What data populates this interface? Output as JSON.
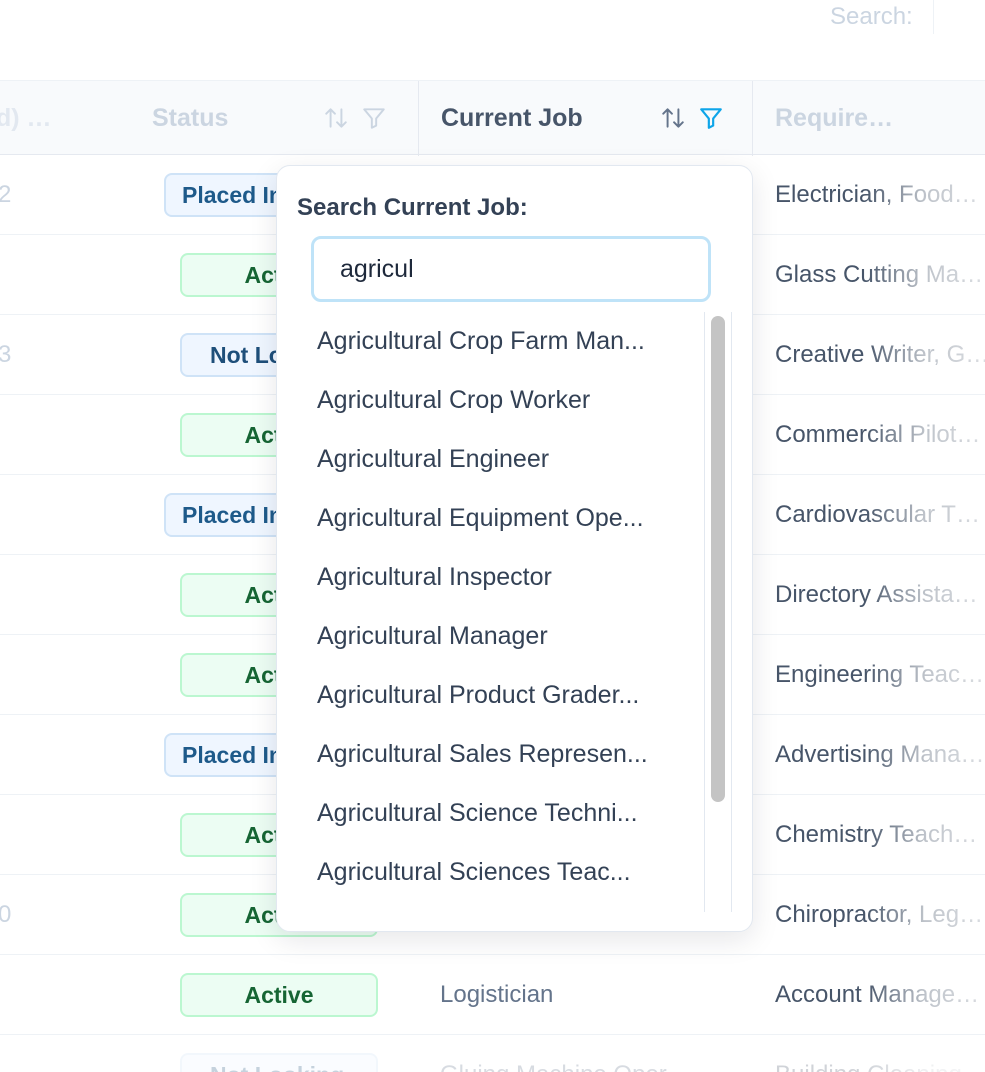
{
  "top_search": {
    "label": "Search:"
  },
  "table": {
    "columns": {
      "prev": "d) …",
      "status": "Status",
      "current_job": "Current Job",
      "required": "Require…"
    },
    "rows": [
      {
        "prev": "2",
        "status": "Placed In Job",
        "status_kind": "placed",
        "job": "",
        "required": "Electrician, Food…"
      },
      {
        "prev": "",
        "status": "Active",
        "status_kind": "active",
        "job": "",
        "required": "Glass Cutting Ma…"
      },
      {
        "prev": "3",
        "status": "Not Looking",
        "status_kind": "notlooking",
        "job": "",
        "required": "Creative Writer, G…"
      },
      {
        "prev": "",
        "status": "Active",
        "status_kind": "active",
        "job": "",
        "required": "Commercial Pilot…"
      },
      {
        "prev": "",
        "status": "Placed In Job",
        "status_kind": "placed",
        "job": "",
        "required": "Cardiovascular T…"
      },
      {
        "prev": "",
        "status": "Active",
        "status_kind": "active",
        "job": "",
        "required": "Directory Assista…"
      },
      {
        "prev": "",
        "status": "Active",
        "status_kind": "active",
        "job": "",
        "required": "Engineering Teac…"
      },
      {
        "prev": "",
        "status": "Placed In Job",
        "status_kind": "placed",
        "job": "",
        "required": "Advertising Mana…"
      },
      {
        "prev": "",
        "status": "Active",
        "status_kind": "active",
        "job": "",
        "required": "Chemistry Teach…"
      },
      {
        "prev": "0",
        "status": "Active",
        "status_kind": "active",
        "job": "",
        "required": "Chiropractor, Leg…"
      },
      {
        "prev": "",
        "status": "Active",
        "status_kind": "active",
        "job": "Logistician",
        "required": "Account Manage…"
      },
      {
        "prev": "",
        "status": "Not Looking",
        "status_kind": "notlooking",
        "job": "Gluing Machine Oper…",
        "required": "Building Cleaning…"
      }
    ]
  },
  "popover": {
    "title": "Search Current Job:",
    "input_value": "agricul",
    "items": [
      "Agricultural Crop Farm Man...",
      "Agricultural Crop Worker",
      "Agricultural Engineer",
      "Agricultural Equipment Ope...",
      "Agricultural Inspector",
      "Agricultural Manager",
      "Agricultural Product Grader...",
      "Agricultural Sales Represen...",
      "Agricultural Science Techni...",
      "Agricultural Sciences Teac..."
    ]
  },
  "colors": {
    "accent_filter_active": "#0ea5e9",
    "active_badge_bg": "#ecfdf3",
    "active_badge_text": "#166534",
    "placed_badge_bg": "#eff6ff",
    "placed_badge_text": "#1e5a8a"
  }
}
